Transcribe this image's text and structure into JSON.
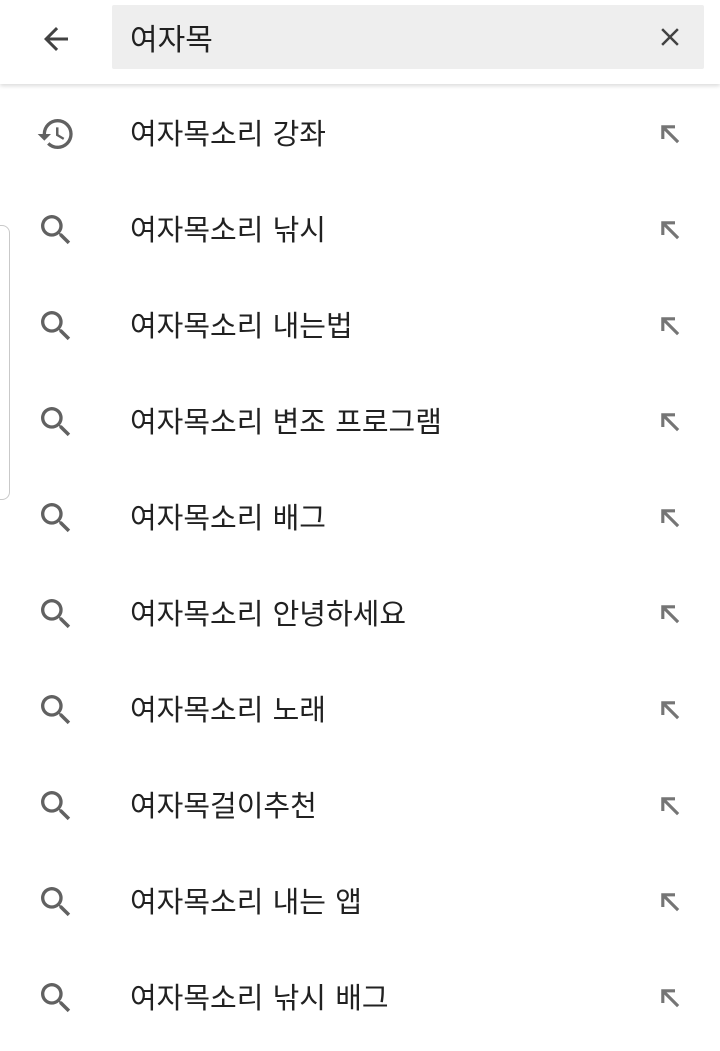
{
  "search": {
    "query": "여자목"
  },
  "suggestions": [
    {
      "text": "여자목소리 강좌",
      "icon": "history-icon"
    },
    {
      "text": "여자목소리 낚시",
      "icon": "search-icon"
    },
    {
      "text": "여자목소리 내는법",
      "icon": "search-icon"
    },
    {
      "text": "여자목소리 변조 프로그램",
      "icon": "search-icon"
    },
    {
      "text": "여자목소리 배그",
      "icon": "search-icon"
    },
    {
      "text": "여자목소리 안녕하세요",
      "icon": "search-icon"
    },
    {
      "text": "여자목소리 노래",
      "icon": "search-icon"
    },
    {
      "text": "여자목걸이추천",
      "icon": "search-icon"
    },
    {
      "text": "여자목소리 내는 앱",
      "icon": "search-icon"
    },
    {
      "text": "여자목소리 낚시 배그",
      "icon": "search-icon"
    }
  ],
  "colors": {
    "icon": "#616161",
    "fill_arrow": "#757575",
    "text": "#212121",
    "field_bg": "#eeeeee"
  }
}
